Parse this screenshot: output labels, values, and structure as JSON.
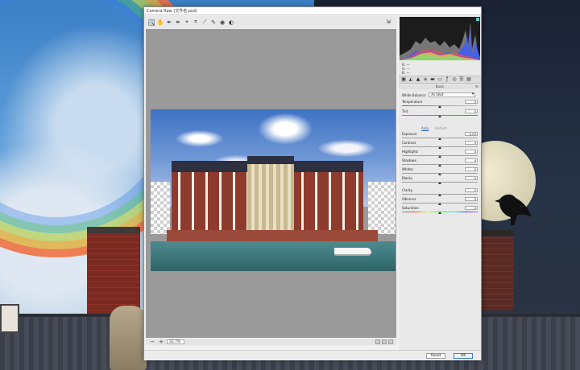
{
  "window": {
    "title": "Camera Raw (文件名.psd)"
  },
  "toolbar": {
    "tools": [
      {
        "name": "zoom-tool",
        "glyph": "🔍",
        "active": true
      },
      {
        "name": "hand-tool",
        "glyph": "✋"
      },
      {
        "name": "white-balance-tool",
        "glyph": "✒"
      },
      {
        "name": "color-sampler-tool",
        "glyph": "✒"
      },
      {
        "name": "targeted-adjustment-tool",
        "glyph": "⌖"
      },
      {
        "name": "crop-tool",
        "glyph": "⌗"
      },
      {
        "name": "straighten-tool",
        "glyph": "⟋"
      },
      {
        "name": "spot-removal-tool",
        "glyph": "✎"
      },
      {
        "name": "red-eye-tool",
        "glyph": "◉"
      },
      {
        "name": "adjustment-brush-tool",
        "glyph": "◐"
      }
    ],
    "preferences_glyph": "⇲"
  },
  "status": {
    "zoom": "32.7%"
  },
  "histogram": {
    "rgb": [
      "R:  ---",
      "G:  ---",
      "B:  ---"
    ]
  },
  "panel": {
    "section": "Basic",
    "white_balance_label": "White Balance:",
    "white_balance_value": "As Shot",
    "auto_label": "Auto",
    "default_label": "Default",
    "sliders_top": [
      {
        "label": "Temperature",
        "value": "0",
        "pos": 0.5,
        "track": "temp"
      },
      {
        "label": "Tint",
        "value": "0",
        "pos": 0.5,
        "track": "tint"
      }
    ],
    "sliders_tone": [
      {
        "label": "Exposure",
        "value": "0.00",
        "pos": 0.5
      },
      {
        "label": "Contrast",
        "value": "0",
        "pos": 0.5
      },
      {
        "label": "Highlights",
        "value": "0",
        "pos": 0.5
      },
      {
        "label": "Shadows",
        "value": "0",
        "pos": 0.5
      },
      {
        "label": "Whites",
        "value": "0",
        "pos": 0.5
      },
      {
        "label": "Blacks",
        "value": "0",
        "pos": 0.5
      }
    ],
    "sliders_presence": [
      {
        "label": "Clarity",
        "value": "0",
        "pos": 0.5
      },
      {
        "label": "Vibrance",
        "value": "0",
        "pos": 0.5
      },
      {
        "label": "Saturation",
        "value": "0",
        "pos": 0.5,
        "track": "sat"
      }
    ]
  },
  "footer": {
    "reset_label": "Reset",
    "ok_label": "OK"
  },
  "colors": {
    "accent": "#3d7fd6",
    "histogram_bg": "#1c1c1c"
  }
}
